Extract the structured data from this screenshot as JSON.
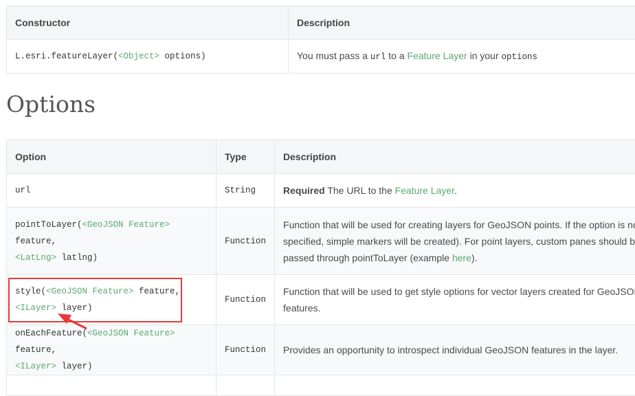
{
  "constructor_table": {
    "headers": [
      "Constructor",
      "Description"
    ],
    "row": {
      "signature": {
        "name": "L.esri.featureLayer(",
        "type": "<Object>",
        "rest": " options)"
      },
      "description": {
        "pre": "You must pass a ",
        "code1": "url",
        "mid": " to a ",
        "link": "Feature Layer",
        "post": " in your ",
        "code2": "options"
      }
    }
  },
  "options_heading": "Options",
  "options_table": {
    "headers": [
      "Option",
      "Type",
      "Description"
    ],
    "rows": [
      {
        "option": {
          "text": "url"
        },
        "type": "String",
        "description": {
          "bold": "Required",
          "pre": " The URL to the ",
          "link": "Feature Layer",
          "post": "."
        }
      },
      {
        "option": {
          "name": "pointToLayer(",
          "type1": "<GeoJSON Feature>",
          "mid": " feature,",
          "type2": "<LatLng>",
          "end": " latlng)"
        },
        "type": "Function",
        "description": {
          "pre": "Function that will be used for creating layers for GeoJSON points. If the option is not specified, simple markers will be created). For point layers, custom panes should be passed through pointToLayer (example ",
          "link": "here",
          "post": ")."
        }
      },
      {
        "option": {
          "name": "style(",
          "type1": "<GeoJSON Feature>",
          "mid": " feature,",
          "type2": "<ILayer>",
          "end": " layer)"
        },
        "type": "Function",
        "description": {
          "text": "Function that will be used to get style options for vector layers created for GeoJSON features."
        }
      },
      {
        "option": {
          "name": "onEachFeature(",
          "type1": "<GeoJSON Feature>",
          "mid": " feature,",
          "type2": "<ILayer>",
          "end": " layer)"
        },
        "type": "Function",
        "description": {
          "text": "Provides an opportunity to introspect individual GeoJSON features in the layer."
        }
      }
    ]
  },
  "colors": {
    "link": "#5aa86f",
    "header_bg": "#f4f6f8",
    "annotation": "#e8393a"
  }
}
